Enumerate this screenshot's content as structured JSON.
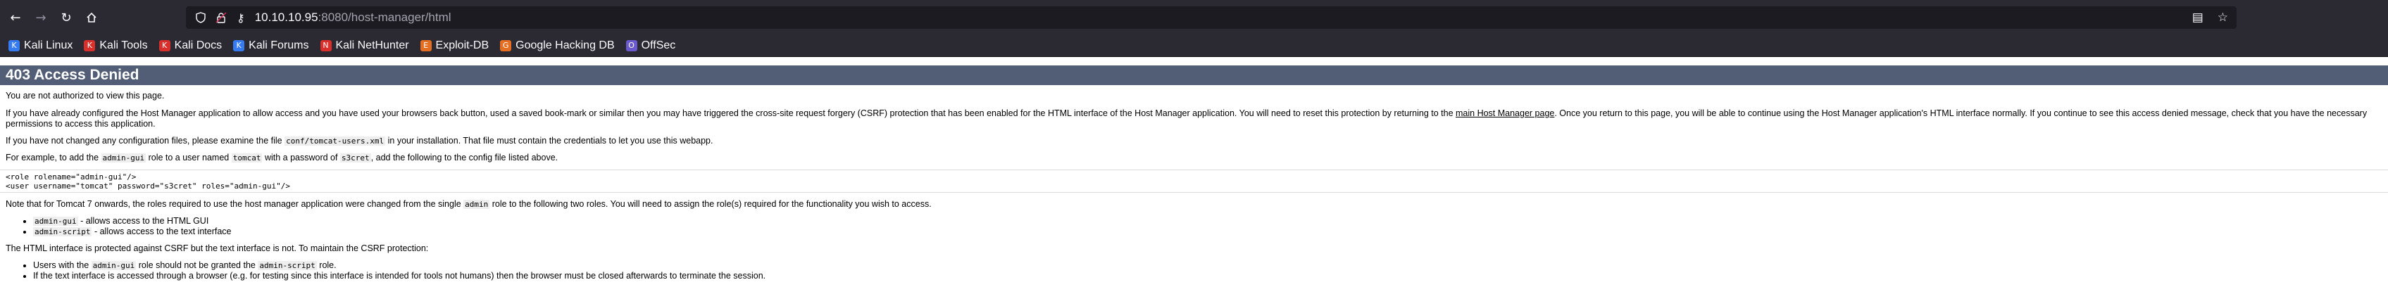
{
  "browser": {
    "url_host": "10.10.10.95",
    "url_path": ":8080/host-manager/html",
    "bookmarks": [
      {
        "label": "Kali Linux",
        "icon": "kali-dragon-icon",
        "color": "#367bf0"
      },
      {
        "label": "Kali Tools",
        "icon": "kali-tools-icon",
        "color": "#d9302c"
      },
      {
        "label": "Kali Docs",
        "icon": "kali-docs-icon",
        "color": "#d9302c"
      },
      {
        "label": "Kali Forums",
        "icon": "kali-forums-icon",
        "color": "#367bf0"
      },
      {
        "label": "Kali NetHunter",
        "icon": "nethunter-icon",
        "color": "#d9302c"
      },
      {
        "label": "Exploit-DB",
        "icon": "exploit-db-icon",
        "color": "#e46f23"
      },
      {
        "label": "Google Hacking DB",
        "icon": "ghdb-icon",
        "color": "#e46f23"
      },
      {
        "label": "OffSec",
        "icon": "offsec-icon",
        "color": "#6a5acd"
      }
    ]
  },
  "page": {
    "heading": "403 Access Denied",
    "p1": "You are not authorized to view this page.",
    "p2_before": "If you have already configured the Host Manager application to allow access and you have used your browsers back button, used a saved book-mark or similar then you may have triggered the cross-site request forgery (CSRF) protection that has been enabled for the HTML interface of the Host Manager application. You will need to reset this protection by returning to the ",
    "p2_link": "main Host Manager page",
    "p2_after": ". Once you return to this page, you will be able to continue using the Host Manager application's HTML interface normally. If you continue to see this access denied message, check that you have the necessary permissions to access this application.",
    "p3_before": "If you have not changed any configuration files, please examine the file ",
    "p3_code": "conf/tomcat-users.xml",
    "p3_after": " in your installation. That file must contain the credentials to let you use this webapp.",
    "p4_a": "For example, to add the ",
    "p4_code1": "admin-gui",
    "p4_b": " role to a user named ",
    "p4_code2": "tomcat",
    "p4_c": " with a password of ",
    "p4_code3": "s3cret",
    "p4_d": ", add the following to the config file listed above.",
    "pre_line1": "<role rolename=\"admin-gui\"/>",
    "pre_line2": "<user username=\"tomcat\" password=\"s3cret\" roles=\"admin-gui\"/>",
    "p5_before": "Note that for Tomcat 7 onwards, the roles required to use the host manager application were changed from the single ",
    "p5_code": "admin",
    "p5_after": " role to the following two roles. You will need to assign the role(s) required for the functionality you wish to access.",
    "roles": [
      {
        "code": "admin-gui",
        "text": " - allows access to the HTML GUI"
      },
      {
        "code": "admin-script",
        "text": " - allows access to the text interface"
      }
    ],
    "p6": "The HTML interface is protected against CSRF but the text interface is not. To maintain the CSRF protection:",
    "csrf_1_a": "Users with the ",
    "csrf_1_code1": "admin-gui",
    "csrf_1_b": " role should not be granted the ",
    "csrf_1_code2": "admin-script",
    "csrf_1_c": " role.",
    "csrf_2": "If the text interface is accessed through a browser (e.g. for testing since this interface is intended for tools not humans) then the browser must be closed afterwards to terminate the session."
  }
}
